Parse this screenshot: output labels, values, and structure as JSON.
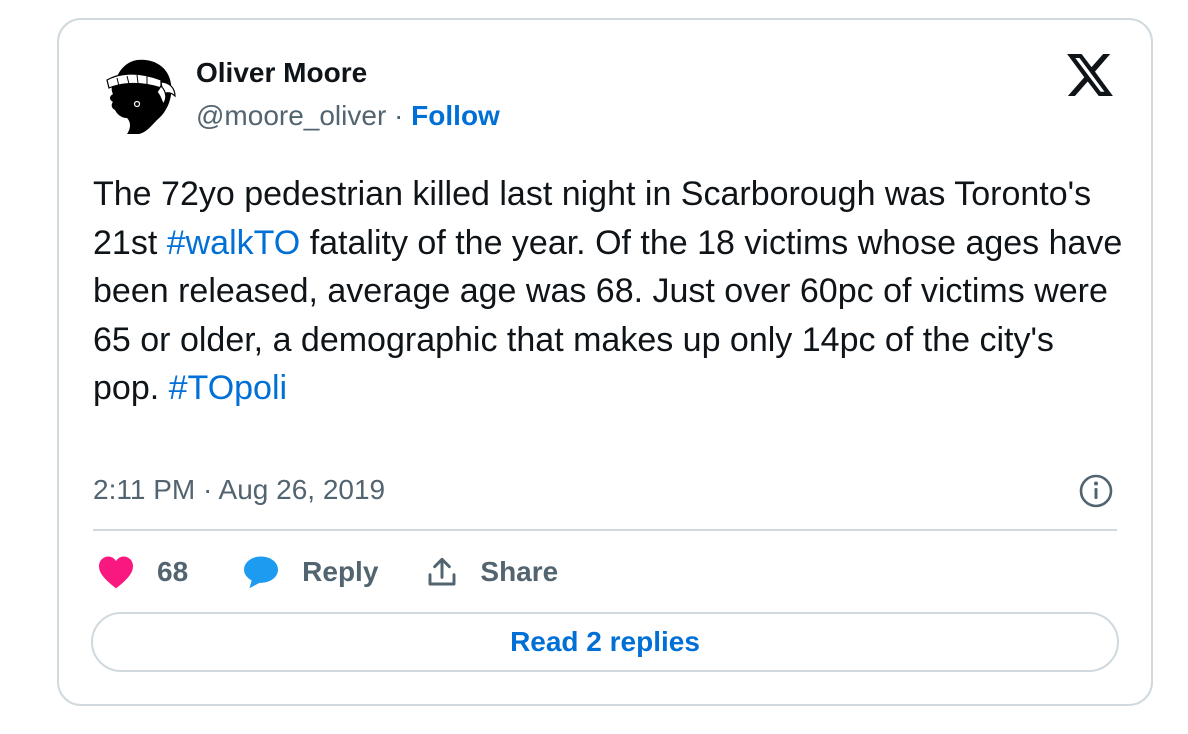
{
  "author": {
    "name": "Oliver Moore",
    "handle": "@moore_oliver",
    "separator": " · ",
    "follow_label": "Follow"
  },
  "tweet": {
    "parts": {
      "p1": "The 72yo pedestrian killed last night in Scarborough was Toronto's 21st ",
      "tag1": "#walkTO",
      "p2": " fatality of the year. Of the 18 victims whose ages have been released, average age was 68. Just over 60pc of victims were 65 or older, a demographic that makes up only 14pc of the city's pop. ",
      "tag2": "#TOpoli"
    },
    "timestamp": "2:11 PM · Aug 26, 2019"
  },
  "actions": {
    "like_count": "68",
    "reply_label": "Reply",
    "share_label": "Share"
  },
  "footer": {
    "read_replies_label": "Read 2 replies"
  },
  "icons": {
    "avatar": "moor-head-avatar",
    "close": "x-logo-icon",
    "info": "info-icon",
    "like": "heart-icon",
    "reply": "speech-bubble-icon",
    "share": "share-upload-icon"
  },
  "colors": {
    "link": "#006fd6",
    "like": "#f91880",
    "reply": "#1d9bf0",
    "muted": "#536471",
    "text": "#0f1419",
    "border": "#cfd9de"
  }
}
